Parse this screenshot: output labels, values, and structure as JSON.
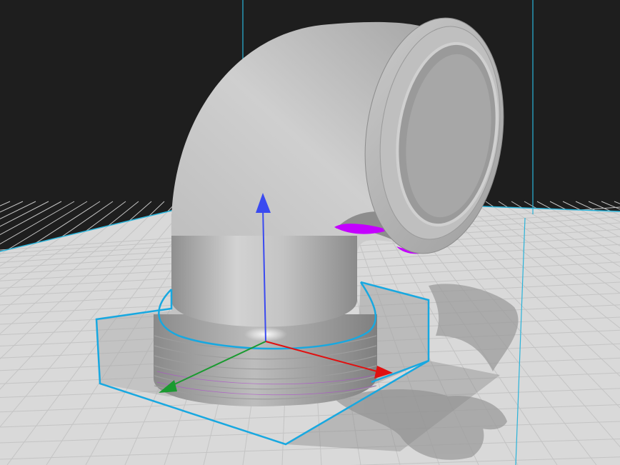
{
  "viewport": {
    "background_color": "#1e1e1e",
    "build_plate_color": "#d9d9d9",
    "grid_line_color": "#c4c4c4",
    "boundary_line_color": "#2ab3d9",
    "selection_outline_color": "#18a8e0",
    "model_color": "#bcbcbc",
    "overhang_highlight_color": "#c400ff",
    "shadow_color": "#9a9a9a"
  },
  "model": {
    "type": "pipe-elbow-fitting",
    "selected": true,
    "features": [
      "threaded-base",
      "90-degree-bend",
      "flanged-outlet"
    ]
  },
  "gizmo": {
    "axes": [
      {
        "name": "x-axis",
        "color": "#e01010"
      },
      {
        "name": "y-axis",
        "color": "#1a9a30"
      },
      {
        "name": "z-axis",
        "color": "#3a4af0"
      }
    ]
  }
}
